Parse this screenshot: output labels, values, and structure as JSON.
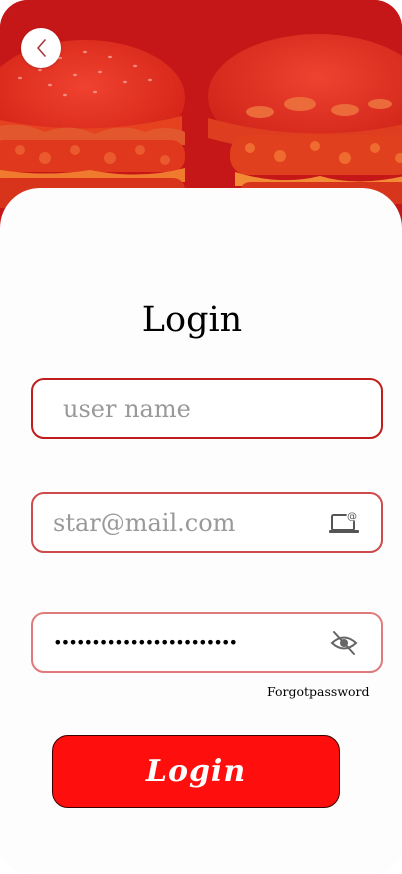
{
  "header": {
    "hero_image": "burgers-photo",
    "back_icon": "chevron-left-icon"
  },
  "page": {
    "title": "Login"
  },
  "form": {
    "username": {
      "placeholder": "user name",
      "value": ""
    },
    "email": {
      "placeholder": "star@mail.com",
      "value": "",
      "icon": "laptop-at-icon"
    },
    "password": {
      "value": "........................",
      "icon": "eye-off-icon"
    },
    "forgot_label": "Forgotpassword",
    "submit_label": "Login"
  },
  "colors": {
    "hero_red": "#c81616",
    "button_red": "#ff0e0e",
    "border_red": "#c11d1d"
  }
}
